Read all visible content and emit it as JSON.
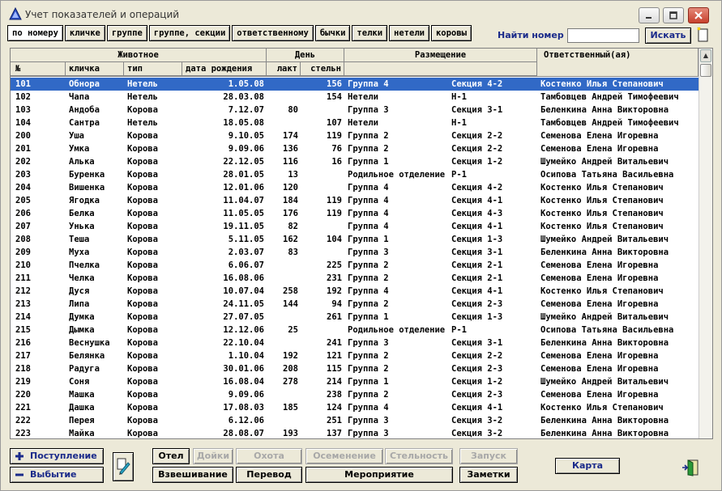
{
  "window": {
    "title": "Учет показателей и операций"
  },
  "sort_buttons": [
    {
      "label": "по номеру",
      "active": true
    },
    {
      "label": "кличке",
      "active": false
    },
    {
      "label": "группе",
      "active": false
    },
    {
      "label": "группе, секции",
      "active": false
    },
    {
      "label": "ответственному",
      "active": false
    },
    {
      "label": "бычки",
      "active": false
    },
    {
      "label": "телки",
      "active": false
    },
    {
      "label": "нетели",
      "active": false
    },
    {
      "label": "коровы",
      "active": false
    }
  ],
  "search": {
    "label": "Найти номер",
    "value": "",
    "button": "Искать"
  },
  "table": {
    "group_headers": {
      "animal": "Животное",
      "day": "День",
      "placement": "Размещение",
      "responsible": "Ответственный(ая)"
    },
    "columns": {
      "num": "№",
      "name": "кличка",
      "type": "тип",
      "birth": "дата рождения",
      "lact": "лакт",
      "preg": "стельн"
    },
    "rows": [
      [
        "101",
        "Обнора",
        "Нетель",
        "1.05.08",
        "",
        "156",
        "Группа 4",
        "Секция 4-2",
        "Костенко Илья Степанович"
      ],
      [
        "102",
        "Чапа",
        "Нетель",
        "28.03.08",
        "",
        "154",
        "Нетели",
        "Н-1",
        "Тамбовцев Андрей Тимофеевич"
      ],
      [
        "103",
        "Андоба",
        "Корова",
        "7.12.07",
        "80",
        "",
        "Группа 3",
        "Секция 3-1",
        "Беленкина Анна Викторовна"
      ],
      [
        "104",
        "Сантра",
        "Нетель",
        "18.05.08",
        "",
        "107",
        "Нетели",
        "Н-1",
        "Тамбовцев Андрей Тимофеевич"
      ],
      [
        "200",
        "Уша",
        "Корова",
        "9.10.05",
        "174",
        "119",
        "Группа 2",
        "Секция  2-2",
        "Семенова Елена Игоревна"
      ],
      [
        "201",
        "Умка",
        "Корова",
        "9.09.06",
        "136",
        "76",
        "Группа 2",
        "Секция  2-2",
        "Семенова Елена Игоревна"
      ],
      [
        "202",
        "Алька",
        "Корова",
        "22.12.05",
        "116",
        "16",
        "Группа 1",
        "Секция  1-2",
        "Шумейко Андрей Витальевич"
      ],
      [
        "203",
        "Буренка",
        "Корова",
        "28.01.05",
        "13",
        "",
        "Родильное отделение",
        "Р-1",
        "Осипова Татьяна Васильевна"
      ],
      [
        "204",
        "Вишенка",
        "Корова",
        "12.01.06",
        "120",
        "",
        "Группа 4",
        "Секция 4-2",
        "Костенко Илья Степанович"
      ],
      [
        "205",
        "Ягодка",
        "Корова",
        "11.04.07",
        "184",
        "119",
        "Группа 4",
        "Секция 4-1",
        "Костенко Илья Степанович"
      ],
      [
        "206",
        "Белка",
        "Корова",
        "11.05.05",
        "176",
        "119",
        "Группа 4",
        "Секция 4-3",
        "Костенко Илья Степанович"
      ],
      [
        "207",
        "Унька",
        "Корова",
        "19.11.05",
        "82",
        "",
        "Группа 4",
        "Секция 4-1",
        "Костенко Илья Степанович"
      ],
      [
        "208",
        "Теша",
        "Корова",
        "5.11.05",
        "162",
        "104",
        "Группа 1",
        "Секция  1-3",
        "Шумейко Андрей Витальевич"
      ],
      [
        "209",
        "Муха",
        "Корова",
        "2.03.07",
        "83",
        "",
        "Группа 3",
        "Секция 3-1",
        "Беленкина Анна Викторовна"
      ],
      [
        "210",
        "Пчелка",
        "Корова",
        "6.06.07",
        "",
        "225",
        "Группа 2",
        "Секция  2-1",
        "Семенова Елена Игоревна"
      ],
      [
        "211",
        "Челка",
        "Корова",
        "16.08.06",
        "",
        "231",
        "Группа 2",
        "Секция  2-1",
        "Семенова Елена Игоревна"
      ],
      [
        "212",
        "Дуся",
        "Корова",
        "10.07.04",
        "258",
        "192",
        "Группа 4",
        "Секция 4-1",
        "Костенко Илья Степанович"
      ],
      [
        "213",
        "Липа",
        "Корова",
        "24.11.05",
        "144",
        "94",
        "Группа 2",
        "Секция  2-3",
        "Семенова Елена Игоревна"
      ],
      [
        "214",
        "Думка",
        "Корова",
        "27.07.05",
        "",
        "261",
        "Группа 1",
        "Секция  1-3",
        "Шумейко Андрей Витальевич"
      ],
      [
        "215",
        "Дымка",
        "Корова",
        "12.12.06",
        "25",
        "",
        "Родильное отделение",
        "Р-1",
        "Осипова Татьяна Васильевна"
      ],
      [
        "216",
        "Веснушка",
        "Корова",
        "22.10.04",
        "",
        "241",
        "Группа 3",
        "Секция 3-1",
        "Беленкина Анна Викторовна"
      ],
      [
        "217",
        "Белянка",
        "Корова",
        "1.10.04",
        "192",
        "121",
        "Группа 2",
        "Секция  2-2",
        "Семенова Елена Игоревна"
      ],
      [
        "218",
        "Радуга",
        "Корова",
        "30.01.06",
        "208",
        "115",
        "Группа 2",
        "Секция  2-3",
        "Семенова Елена Игоревна"
      ],
      [
        "219",
        "Соня",
        "Корова",
        "16.08.04",
        "278",
        "214",
        "Группа 1",
        "Секция  1-2",
        "Шумейко Андрей Витальевич"
      ],
      [
        "220",
        "Машка",
        "Корова",
        "9.09.06",
        "",
        "238",
        "Группа 2",
        "Секция  2-3",
        "Семенова Елена Игоревна"
      ],
      [
        "221",
        "Дашка",
        "Корова",
        "17.08.03",
        "185",
        "124",
        "Группа 4",
        "Секция 4-1",
        "Костенко Илья Степанович"
      ],
      [
        "222",
        "Перея",
        "Корова",
        "6.12.06",
        "",
        "251",
        "Группа 3",
        "Секция 3-2",
        "Беленкина Анна Викторовна"
      ],
      [
        "223",
        "Майка",
        "Корова",
        "28.08.07",
        "193",
        "137",
        "Группа 3",
        "Секция 3-2",
        "Беленкина Анна Викторовна"
      ]
    ],
    "selected_index": 0
  },
  "bottom": {
    "arrival": "Поступление",
    "departure": "Выбытие",
    "otel": "Отел",
    "doiki": "Дойки",
    "ohota": "Охота",
    "osemenenie": "Осеменение",
    "stelnost": "Стельность",
    "zapusk": "Запуск",
    "vzveshivanie": "Взвешивание",
    "perevod": "Перевод",
    "meropriyatie": "Мероприятие",
    "zametki": "Заметки",
    "karta": "Карта"
  },
  "colors": {
    "selection": "#3169c6",
    "accent_text": "#1a2a8a",
    "disabled_text": "#a8a8a8"
  }
}
